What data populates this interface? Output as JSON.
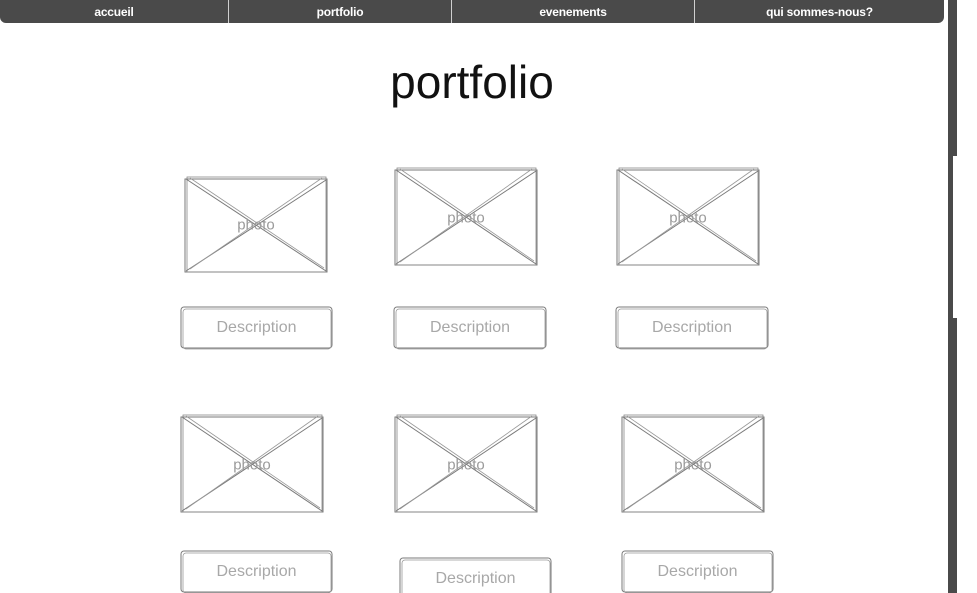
{
  "nav": {
    "items": [
      {
        "label": "accueil"
      },
      {
        "label": "portfolio"
      },
      {
        "label": "evenements"
      },
      {
        "label": "qui sommes-nous?"
      }
    ]
  },
  "page": {
    "title": "portfolio"
  },
  "gallery": {
    "items": [
      {
        "photo_label": "photo",
        "description": "Description"
      },
      {
        "photo_label": "photo",
        "description": "Description"
      },
      {
        "photo_label": "photo",
        "description": "Description"
      },
      {
        "photo_label": "photo",
        "description": "Description"
      },
      {
        "photo_label": "photo",
        "description": "Description"
      },
      {
        "photo_label": "photo",
        "description": "Description"
      }
    ]
  },
  "colors": {
    "nav_background": "#4a4a4a",
    "sketch_stroke": "#7a7a7a",
    "placeholder_text": "#a8a8a8"
  }
}
